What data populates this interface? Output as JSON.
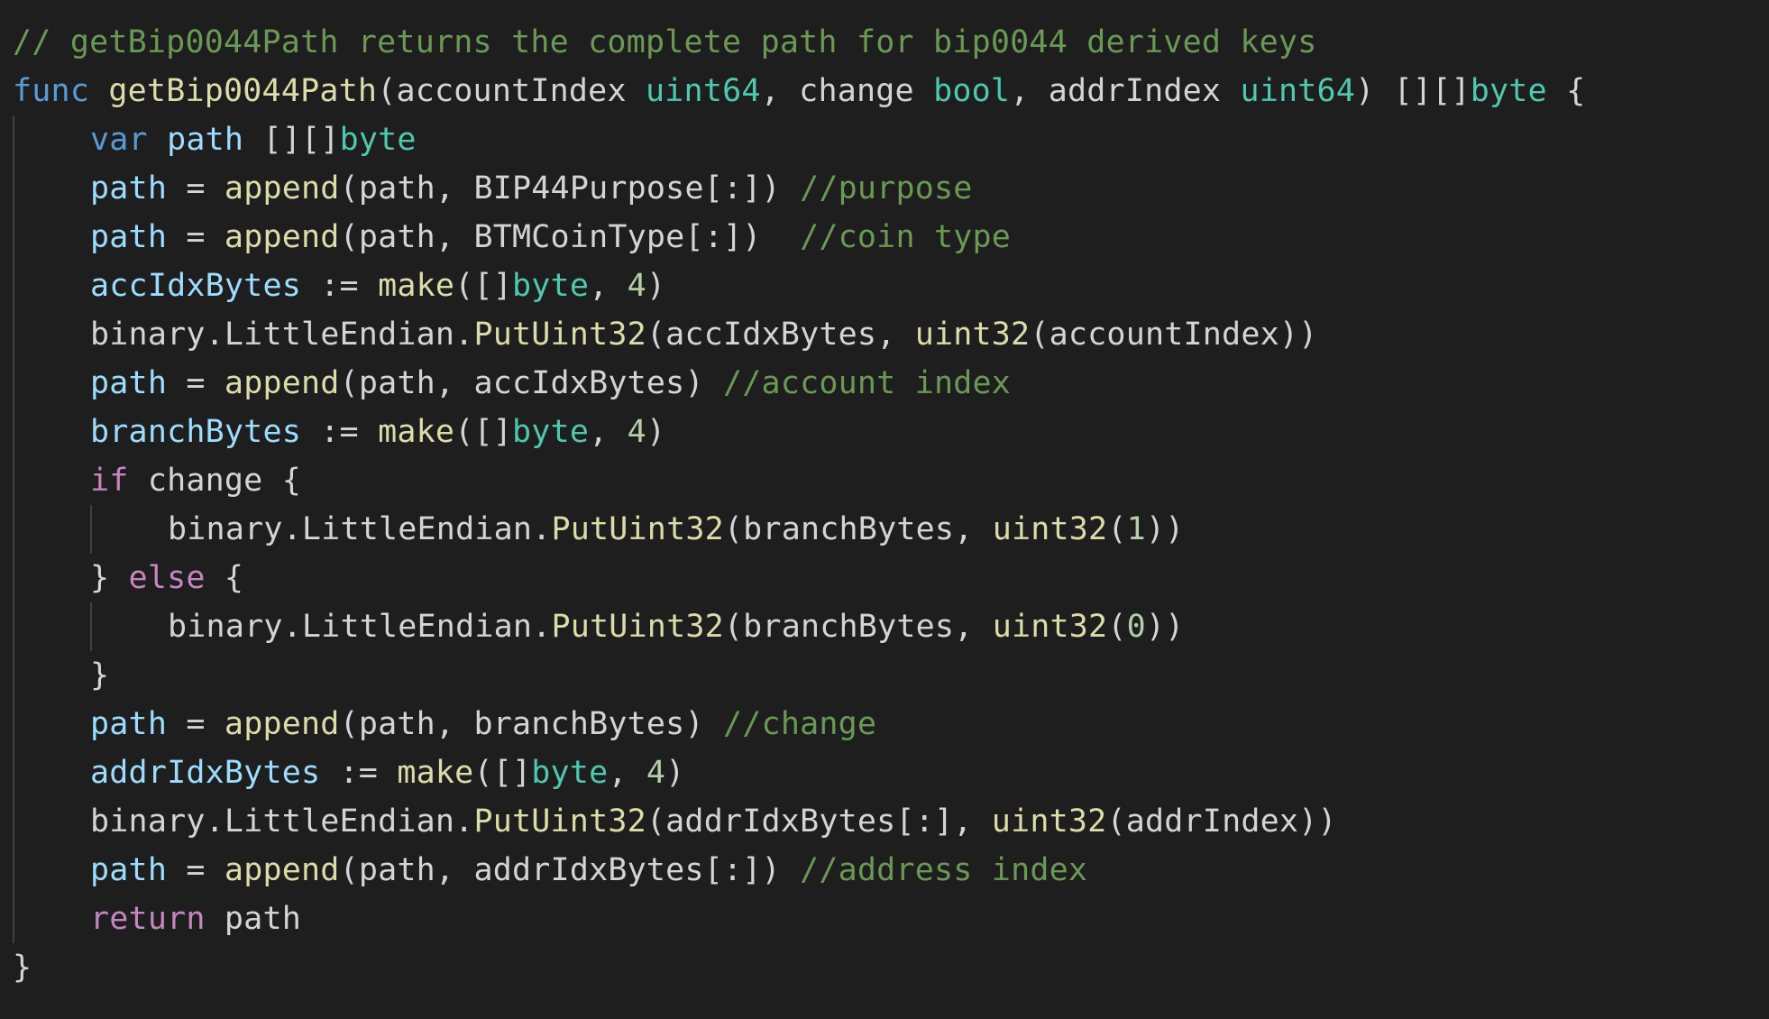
{
  "colors": {
    "background": "#1e1e1e",
    "comment": "#6a9955",
    "keyword": "#569cd6",
    "control": "#c586c0",
    "function": "#dcdcaa",
    "type": "#4ec9b0",
    "variable": "#9cdcfe",
    "number": "#b5cea8",
    "text": "#d4d4d4",
    "indent_guide": "#404040"
  },
  "code": {
    "lines": [
      {
        "indent": 0,
        "guides": 0,
        "tokens": [
          {
            "t": "// getBip0044Path returns the complete path for bip0044 derived keys",
            "c": "comment"
          }
        ]
      },
      {
        "indent": 0,
        "guides": 0,
        "tokens": [
          {
            "t": "func",
            "c": "keyword"
          },
          {
            "t": " ",
            "c": "text"
          },
          {
            "t": "getBip0044Path",
            "c": "function"
          },
          {
            "t": "(accountIndex ",
            "c": "text"
          },
          {
            "t": "uint64",
            "c": "type"
          },
          {
            "t": ", change ",
            "c": "text"
          },
          {
            "t": "bool",
            "c": "type"
          },
          {
            "t": ", addrIndex ",
            "c": "text"
          },
          {
            "t": "uint64",
            "c": "type"
          },
          {
            "t": ") [][]",
            "c": "text"
          },
          {
            "t": "byte",
            "c": "type"
          },
          {
            "t": " {",
            "c": "text"
          }
        ]
      },
      {
        "indent": 1,
        "guides": 1,
        "tokens": [
          {
            "t": "var",
            "c": "keyword"
          },
          {
            "t": " ",
            "c": "text"
          },
          {
            "t": "path",
            "c": "variable"
          },
          {
            "t": " [][]",
            "c": "text"
          },
          {
            "t": "byte",
            "c": "type"
          }
        ]
      },
      {
        "indent": 1,
        "guides": 1,
        "tokens": [
          {
            "t": "path",
            "c": "variable"
          },
          {
            "t": " = ",
            "c": "text"
          },
          {
            "t": "append",
            "c": "function"
          },
          {
            "t": "(path, BIP44Purpose[:]) ",
            "c": "text"
          },
          {
            "t": "//purpose",
            "c": "comment"
          }
        ]
      },
      {
        "indent": 1,
        "guides": 1,
        "tokens": [
          {
            "t": "path",
            "c": "variable"
          },
          {
            "t": " = ",
            "c": "text"
          },
          {
            "t": "append",
            "c": "function"
          },
          {
            "t": "(path, BTMCoinType[:])  ",
            "c": "text"
          },
          {
            "t": "//coin type",
            "c": "comment"
          }
        ]
      },
      {
        "indent": 1,
        "guides": 1,
        "tokens": [
          {
            "t": "accIdxBytes",
            "c": "variable"
          },
          {
            "t": " := ",
            "c": "text"
          },
          {
            "t": "make",
            "c": "function"
          },
          {
            "t": "([]",
            "c": "text"
          },
          {
            "t": "byte",
            "c": "type"
          },
          {
            "t": ", ",
            "c": "text"
          },
          {
            "t": "4",
            "c": "number"
          },
          {
            "t": ")",
            "c": "text"
          }
        ]
      },
      {
        "indent": 1,
        "guides": 1,
        "tokens": [
          {
            "t": "binary.LittleEndian.",
            "c": "text"
          },
          {
            "t": "PutUint32",
            "c": "function"
          },
          {
            "t": "(accIdxBytes, ",
            "c": "text"
          },
          {
            "t": "uint32",
            "c": "function"
          },
          {
            "t": "(accountIndex))",
            "c": "text"
          }
        ]
      },
      {
        "indent": 1,
        "guides": 1,
        "tokens": [
          {
            "t": "path",
            "c": "variable"
          },
          {
            "t": " = ",
            "c": "text"
          },
          {
            "t": "append",
            "c": "function"
          },
          {
            "t": "(path, accIdxBytes) ",
            "c": "text"
          },
          {
            "t": "//account index",
            "c": "comment"
          }
        ]
      },
      {
        "indent": 1,
        "guides": 1,
        "tokens": [
          {
            "t": "branchBytes",
            "c": "variable"
          },
          {
            "t": " := ",
            "c": "text"
          },
          {
            "t": "make",
            "c": "function"
          },
          {
            "t": "([]",
            "c": "text"
          },
          {
            "t": "byte",
            "c": "type"
          },
          {
            "t": ", ",
            "c": "text"
          },
          {
            "t": "4",
            "c": "number"
          },
          {
            "t": ")",
            "c": "text"
          }
        ]
      },
      {
        "indent": 1,
        "guides": 1,
        "tokens": [
          {
            "t": "if",
            "c": "control"
          },
          {
            "t": " change {",
            "c": "text"
          }
        ]
      },
      {
        "indent": 2,
        "guides": 2,
        "tokens": [
          {
            "t": "binary.LittleEndian.",
            "c": "text"
          },
          {
            "t": "PutUint32",
            "c": "function"
          },
          {
            "t": "(branchBytes, ",
            "c": "text"
          },
          {
            "t": "uint32",
            "c": "function"
          },
          {
            "t": "(",
            "c": "text"
          },
          {
            "t": "1",
            "c": "number"
          },
          {
            "t": "))",
            "c": "text"
          }
        ]
      },
      {
        "indent": 1,
        "guides": 1,
        "tokens": [
          {
            "t": "} ",
            "c": "text"
          },
          {
            "t": "else",
            "c": "control"
          },
          {
            "t": " {",
            "c": "text"
          }
        ]
      },
      {
        "indent": 2,
        "guides": 2,
        "tokens": [
          {
            "t": "binary.LittleEndian.",
            "c": "text"
          },
          {
            "t": "PutUint32",
            "c": "function"
          },
          {
            "t": "(branchBytes, ",
            "c": "text"
          },
          {
            "t": "uint32",
            "c": "function"
          },
          {
            "t": "(",
            "c": "text"
          },
          {
            "t": "0",
            "c": "number"
          },
          {
            "t": "))",
            "c": "text"
          }
        ]
      },
      {
        "indent": 1,
        "guides": 1,
        "tokens": [
          {
            "t": "}",
            "c": "text"
          }
        ]
      },
      {
        "indent": 1,
        "guides": 1,
        "tokens": [
          {
            "t": "path",
            "c": "variable"
          },
          {
            "t": " = ",
            "c": "text"
          },
          {
            "t": "append",
            "c": "function"
          },
          {
            "t": "(path, branchBytes) ",
            "c": "text"
          },
          {
            "t": "//change",
            "c": "comment"
          }
        ]
      },
      {
        "indent": 1,
        "guides": 1,
        "tokens": [
          {
            "t": "addrIdxBytes",
            "c": "variable"
          },
          {
            "t": " := ",
            "c": "text"
          },
          {
            "t": "make",
            "c": "function"
          },
          {
            "t": "([]",
            "c": "text"
          },
          {
            "t": "byte",
            "c": "type"
          },
          {
            "t": ", ",
            "c": "text"
          },
          {
            "t": "4",
            "c": "number"
          },
          {
            "t": ")",
            "c": "text"
          }
        ]
      },
      {
        "indent": 1,
        "guides": 1,
        "tokens": [
          {
            "t": "binary.LittleEndian.",
            "c": "text"
          },
          {
            "t": "PutUint32",
            "c": "function"
          },
          {
            "t": "(addrIdxBytes[:], ",
            "c": "text"
          },
          {
            "t": "uint32",
            "c": "function"
          },
          {
            "t": "(addrIndex))",
            "c": "text"
          }
        ]
      },
      {
        "indent": 1,
        "guides": 1,
        "tokens": [
          {
            "t": "path",
            "c": "variable"
          },
          {
            "t": " = ",
            "c": "text"
          },
          {
            "t": "append",
            "c": "function"
          },
          {
            "t": "(path, addrIdxBytes[:]) ",
            "c": "text"
          },
          {
            "t": "//address index",
            "c": "comment"
          }
        ]
      },
      {
        "indent": 1,
        "guides": 1,
        "tokens": [
          {
            "t": "return",
            "c": "control"
          },
          {
            "t": " path",
            "c": "text"
          }
        ]
      },
      {
        "indent": 0,
        "guides": 0,
        "tokens": [
          {
            "t": "}",
            "c": "text"
          }
        ]
      }
    ]
  }
}
